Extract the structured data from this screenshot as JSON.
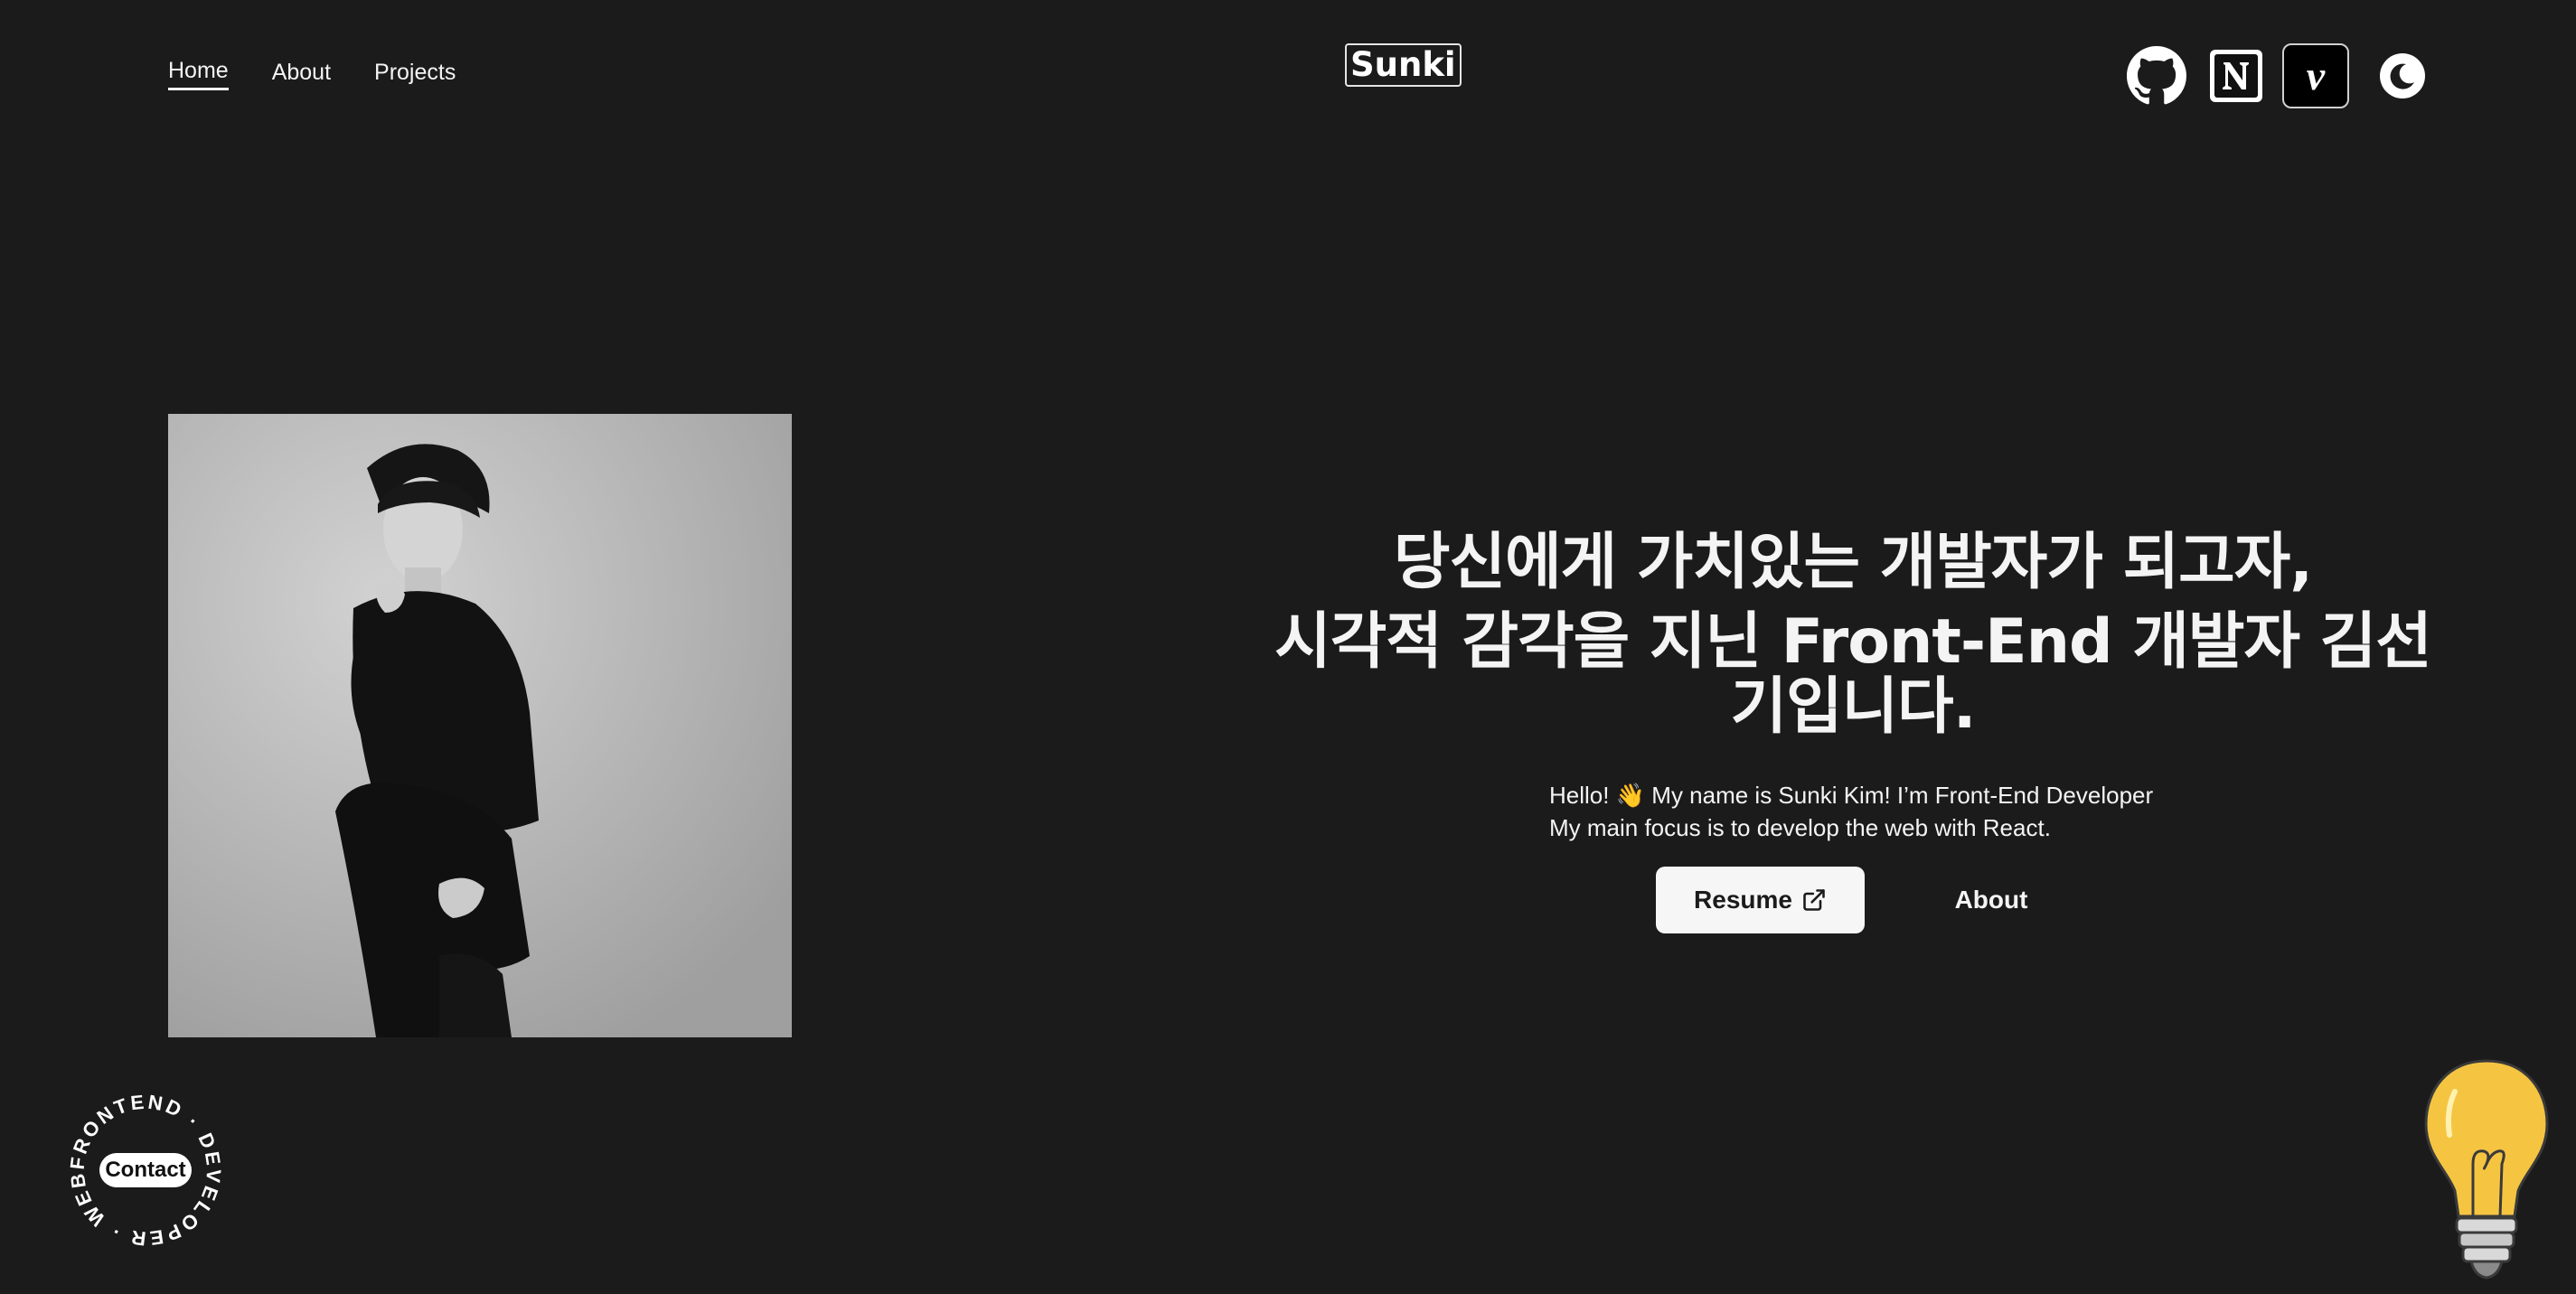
{
  "nav": {
    "items": [
      {
        "label": "Home",
        "active": true
      },
      {
        "label": "About",
        "active": false
      },
      {
        "label": "Projects",
        "active": false
      }
    ]
  },
  "logo": {
    "text": "Sunki"
  },
  "social": {
    "icons": [
      "github-icon",
      "notion-icon",
      "velog-icon",
      "moon-icon"
    ]
  },
  "hero": {
    "headline_line1": "당신에게 가치있는 개발자가 되고자,",
    "headline_line2": "시각적 감각을 지닌 Front-End 개발자 김선기입니다.",
    "intro_line1": "Hello! 👋 My name is Sunki Kim! I’m Front-End Developer",
    "intro_line2": "My main focus is to develop the web with React.",
    "resume_label": "Resume",
    "about_label": "About"
  },
  "contact": {
    "label": "Contact",
    "ring_text": "FRONTEND · DEVELOPER · WEB · "
  },
  "colors": {
    "background": "#1b1b1c",
    "text": "#f4f4f4",
    "button_bg": "#f6f6f6",
    "bulb": "#f5c542"
  }
}
